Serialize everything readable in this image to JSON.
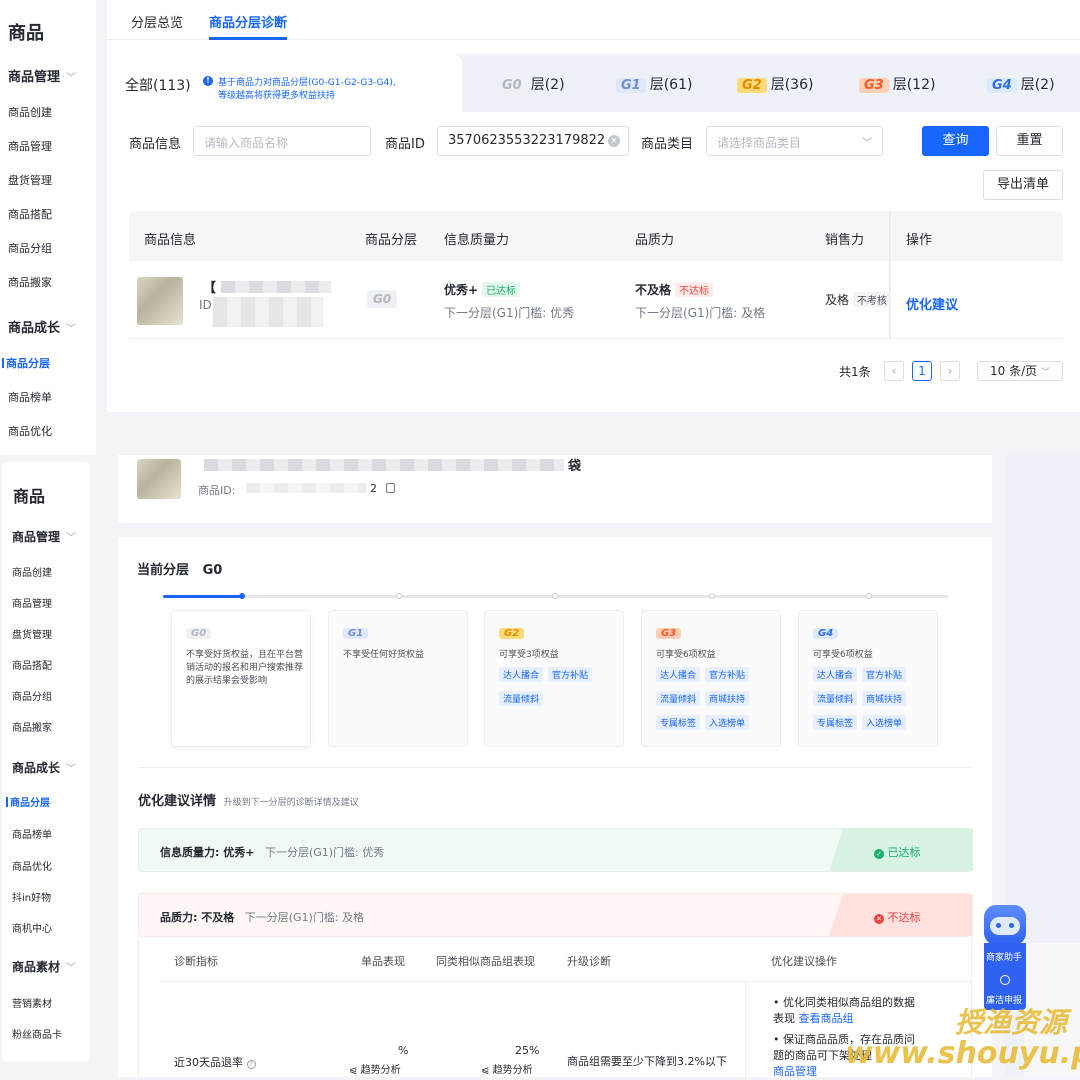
{
  "sidebar_top": {
    "title": "商品",
    "groups": [
      {
        "label": "商品管理",
        "items": [
          "商品创建",
          "商品管理",
          "盘货管理",
          "商品搭配",
          "商品分组",
          "商品搬家"
        ]
      },
      {
        "label": "商品成长",
        "items": [
          "商品分层",
          "商品榜单",
          "商品优化"
        ]
      }
    ]
  },
  "sidebar_bottom": {
    "title": "商品",
    "groups": [
      {
        "label": "商品管理",
        "items": [
          "商品创建",
          "商品管理",
          "盘货管理",
          "商品搭配",
          "商品分组",
          "商品搬家"
        ]
      },
      {
        "label": "商品成长",
        "items": [
          "商品分层",
          "商品榜单",
          "商品优化",
          "抖in好物",
          "商机中心"
        ]
      },
      {
        "label": "商品素材",
        "items": [
          "营销素材",
          "粉丝商品卡"
        ]
      }
    ]
  },
  "tabs": [
    "分层总览",
    "商品分层诊断"
  ],
  "layers": {
    "all": "全部(113)",
    "note_line1": "基于商品力对商品分层(G0-G1-G2-G3-G4),",
    "note_line2": "等级越高将获得更多权益扶持",
    "items": [
      {
        "badge": "G0",
        "label": "层(2)"
      },
      {
        "badge": "G1",
        "label": "层(61)"
      },
      {
        "badge": "G2",
        "label": "层(36)"
      },
      {
        "badge": "G3",
        "label": "层(12)"
      },
      {
        "badge": "G4",
        "label": "层(2)"
      }
    ]
  },
  "filters": {
    "info_label": "商品信息",
    "info_placeholder": "请输入商品名称",
    "id_label": "商品ID",
    "id_value": "3570623553223179822",
    "cat_label": "商品类目",
    "cat_placeholder": "请选择商品类目",
    "query": "查询",
    "reset": "重置",
    "export": "导出清单"
  },
  "table": {
    "headers": [
      "商品信息",
      "商品分层",
      "信息质量力",
      "品质力",
      "销售力",
      "操作"
    ],
    "row": {
      "title_prefix": "【",
      "id_prefix": "ID",
      "layer": "G0",
      "info_q": "优秀+",
      "info_tag": "已达标",
      "info_sub": "下一分层(G1)门槛: 优秀",
      "quality": "不及格",
      "quality_tag": "不达标",
      "quality_sub": "下一分层(G1)门槛: 及格",
      "sales": "及格",
      "sales_tag": "不考核",
      "action": "优化建议"
    }
  },
  "pagination": {
    "total": "共1条",
    "page": "1",
    "size": "10 条/页"
  },
  "product": {
    "title_suffix": "袋",
    "id_label": "商品ID:",
    "id_tail": "2"
  },
  "current": {
    "label": "当前分层",
    "value": "G0"
  },
  "cards": [
    {
      "badge": "G0",
      "desc": "不享受好货权益，且在平台营销活动的报名和用户搜索推荐的展示结果会受影响",
      "chips": []
    },
    {
      "badge": "G1",
      "desc": "不享受任何好货权益",
      "chips": []
    },
    {
      "badge": "G2",
      "desc": "可享受3项权益",
      "chips": [
        "达人播合",
        "官方补贴",
        "流量倾斜"
      ]
    },
    {
      "badge": "G3",
      "desc": "可享受6项权益",
      "chips": [
        "达人播合",
        "官方补贴",
        "流量倾斜",
        "商城扶持",
        "专属标签",
        "入选榜单"
      ]
    },
    {
      "badge": "G4",
      "desc": "可享受6项权益",
      "chips": [
        "达人播合",
        "官方补贴",
        "流量倾斜",
        "商城扶持",
        "专属标签",
        "入选榜单"
      ]
    }
  ],
  "advice": {
    "title": "优化建议详情",
    "subtitle": "升级到下一分层的诊断详情及建议",
    "info": {
      "label": "信息质量力: 优秀+",
      "threshold": "下一分层(G1)门槛: 优秀",
      "status": "已达标"
    },
    "quality": {
      "label": "品质力: 不及格",
      "threshold": "下一分层(G1)门槛: 及格",
      "status": "不达标"
    },
    "headers": [
      "诊断指标",
      "单品表现",
      "同类相似商品组表现",
      "升级诊断",
      "优化建议操作"
    ],
    "row": {
      "metric": "近30天品退率",
      "single": "%",
      "group": "25%",
      "trend": "趋势分析",
      "diagnosis": "商品组需要至少下降到3.2%以下",
      "tip1": "优化同类相似商品组的数据表现",
      "tip1_link": "查看商品组",
      "tip2": "保证商品品质，存在品质问题的商品可下架处理",
      "tip2_link": "商品管理"
    }
  },
  "assistant": {
    "label": "商家助手",
    "label2": "廉洁申报"
  },
  "watermark": {
    "line1": "授渔资源",
    "line2": "www.shouyu.pw"
  },
  "colors": {
    "primary": "#1966ff",
    "success": "#14b26a",
    "danger": "#f53f3f"
  }
}
